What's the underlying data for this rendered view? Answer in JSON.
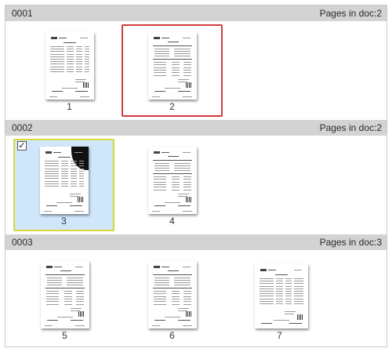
{
  "documents": [
    {
      "id": "0001",
      "pages_label": "Pages in doc:2",
      "pages": [
        {
          "number": "1",
          "state": "normal",
          "layout": "table"
        },
        {
          "number": "2",
          "state": "focused",
          "layout": "form"
        }
      ]
    },
    {
      "id": "0002",
      "pages_label": "Pages in doc:2",
      "pages": [
        {
          "number": "3",
          "state": "selected",
          "layout": "table",
          "checked": true,
          "check_glyph": "✓"
        },
        {
          "number": "4",
          "state": "normal",
          "layout": "form"
        }
      ]
    },
    {
      "id": "0003",
      "pages_label": "Pages in doc:3",
      "pages": [
        {
          "number": "5",
          "state": "normal",
          "layout": "form"
        },
        {
          "number": "6",
          "state": "normal",
          "layout": "form"
        },
        {
          "number": "7",
          "state": "normal",
          "layout": "landscape-table"
        }
      ]
    }
  ],
  "colors": {
    "header_bg": "#d3d3d3",
    "focus_border": "#d23b3b",
    "selected_bg": "#cfe6fb",
    "selected_border": "#d9d83a"
  }
}
